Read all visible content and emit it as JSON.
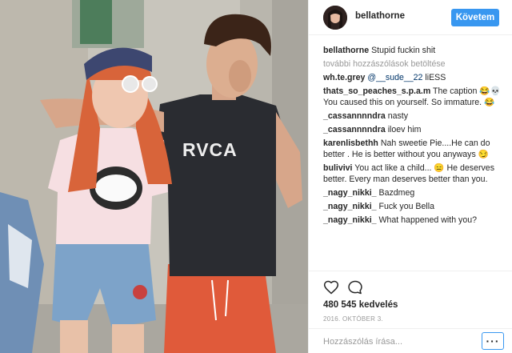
{
  "colors": {
    "accent": "#3897f0",
    "muted": "#999999",
    "mention": "#003569"
  },
  "post": {
    "photo_alt": "",
    "shirt_logo": "RVCA"
  },
  "header": {
    "username": "bellathorne",
    "follow_label": "Követem"
  },
  "caption": {
    "user": "bellathorne",
    "text": "Stupid fuckin shit"
  },
  "load_more_label": "további hozzászólások betöltése",
  "comments": [
    {
      "user": "wh.te.grey",
      "mention": "@__sude__22",
      "text": "liESS"
    },
    {
      "user": "thats_so_peaches_s.p.a.m",
      "text": "The caption 😂💀 You caused this on yourself. So immature. 😂"
    },
    {
      "user": "_cassannnndra",
      "text": "nasty"
    },
    {
      "user": "_cassannnndra",
      "text": "iloev him"
    },
    {
      "user": "karenlisbethh",
      "text": "Nah sweetie Pie....He can do better . He is better without you anyways 😏"
    },
    {
      "user": "bulivivi",
      "text": "You act like a child... 😑 He deserves better. Every man deserves better than you."
    },
    {
      "user": "_nagy_nikki_",
      "text": "Bazdmeg"
    },
    {
      "user": "_nagy_nikki_",
      "text": "Fuck you Bella"
    },
    {
      "user": "_nagy_nikki_",
      "text": "What happened with you?"
    }
  ],
  "actions": {
    "like_icon": "heart-icon",
    "comment_icon": "comment-bubble-icon",
    "likes_text": "480 545 kedvelés",
    "date_text": "2016. OKTÓBER 3."
  },
  "comment_bar": {
    "placeholder": "Hozzászólás írása...",
    "more_label": "···"
  }
}
